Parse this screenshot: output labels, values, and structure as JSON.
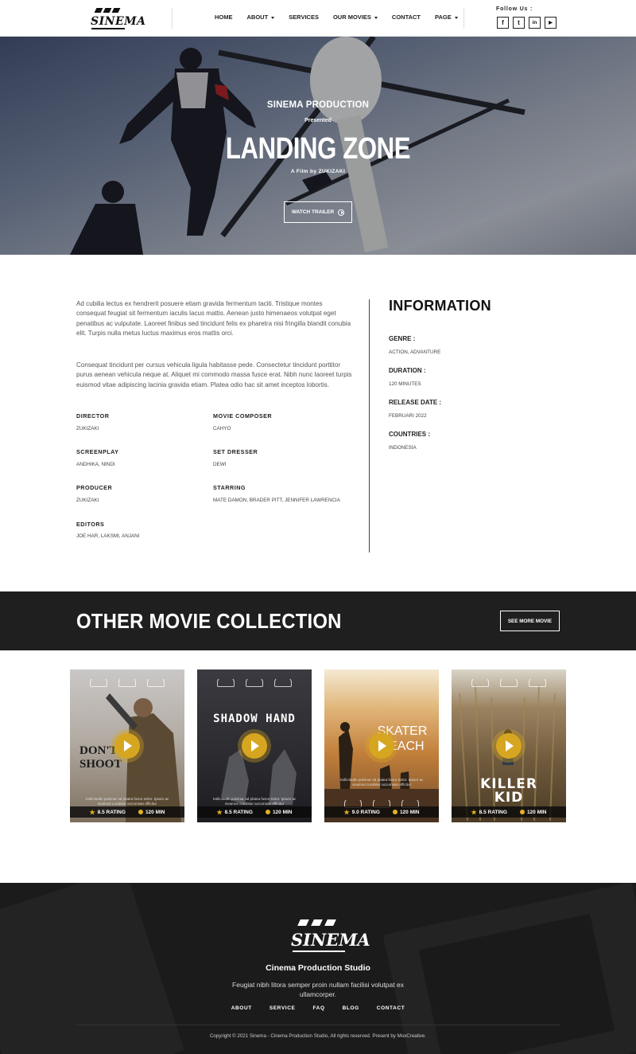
{
  "header": {
    "logo_text": "SINEMA",
    "nav": [
      {
        "label": "HOME",
        "dropdown": false
      },
      {
        "label": "ABOUT",
        "dropdown": true
      },
      {
        "label": "SERVICES",
        "dropdown": false
      },
      {
        "label": "OUR MOVIES",
        "dropdown": true
      },
      {
        "label": "CONTACT",
        "dropdown": false
      },
      {
        "label": "PAGE",
        "dropdown": true
      }
    ],
    "follow_label": "Follow Us :",
    "social": [
      {
        "icon": "facebook-icon",
        "glyph": "f"
      },
      {
        "icon": "twitter-icon",
        "glyph": "t"
      },
      {
        "icon": "linkedin-icon",
        "glyph": "in"
      },
      {
        "icon": "youtube-icon",
        "glyph": "▶"
      }
    ]
  },
  "hero": {
    "studio": "SINEMA PRODUCTION",
    "presented": "Presented",
    "title": "LANDING ZONE",
    "byline": "A Film by ZUKIZAKI",
    "button_label": "WATCH TRAILER"
  },
  "details": {
    "paragraphs": [
      "Ad cubilia lectus ex hendrerit posuere etiam gravida fermentum taciti. Tristique montes consequat feugiat sit fermentum iaculis lacus mattis. Aenean justo himenaeos volutpat eget penatibus ac vulputate. Laoreet finibus sed tincidunt felis ex pharetra nisi fringilla blandit conubia elit. Turpis nulla metus luctus maximus eros mattis orci.",
      "Consequat tincidunt per cursus vehicula ligula habitasse pede. Consectetur tincidunt porttitor purus aenean vehicula neque at. Aliquet mi commodo massa fusce erat. Nibh nunc laoreet turpis euismod vitae adipiscing lacinia gravida etiam. Platea odio hac sit amet inceptos lobortis."
    ],
    "credits": [
      {
        "label": "DIRECTOR",
        "value": "ZUKIZAKI"
      },
      {
        "label": "MOVIE COMPOSER",
        "value": "CAHYO"
      },
      {
        "label": "SCREENPLAY",
        "value": "ANDHIKA, NINDI"
      },
      {
        "label": "SET DRESSER",
        "value": "DEWI"
      },
      {
        "label": "PRODUCER",
        "value": "ZUKIZAKI"
      },
      {
        "label": "STARRING",
        "value": "MATE DAMON, BRADER PITT, JENNIFER LAWRENCIA"
      },
      {
        "label": "EDITORS",
        "value": "JOE HAR, LAKSMI, ANJANI"
      }
    ]
  },
  "information": {
    "title": "INFORMATION",
    "items": [
      {
        "label": "GENRE :",
        "value": "ACTION, ADVANTURE"
      },
      {
        "label": "DURATION :",
        "value": "120 MINUTES"
      },
      {
        "label": "RELEASE DATE :",
        "value": "FEBRUARI 2022"
      },
      {
        "label": "COUNTRIES :",
        "value": "INDONESIA"
      }
    ]
  },
  "collection": {
    "title": "OTHER MOVIE COLLECTION",
    "button_label": "SEE MORE MOVIE",
    "movies": [
      {
        "poster_title_lines": [
          "DON'T",
          "SHOOT"
        ],
        "rating": "8.5 RATING",
        "duration": "120 MIN",
        "tiny": "Sollicitudin pulvinar ad platea fusce tortor. Ipsum ac vivamus curabitur accumsan efficitur",
        "bg": "#9a8f83"
      },
      {
        "poster_title_lines": [
          "SHADOW HAND"
        ],
        "rating": "8.5 RATING",
        "duration": "120 MIN",
        "tiny": "Sollicitudin pulvinar ad platea fusce tortor. Ipsum ac vivamus curabitur accumsan efficitur",
        "bg": "#2d2d33"
      },
      {
        "poster_title_lines": [
          "SKATER",
          "BEACH"
        ],
        "rating": "9.0 RATING",
        "duration": "120 MIN",
        "tiny": "Sollicitudin pulvinar ad platea fusce tortor. Ipsum ac vivamus curabitur accumsan efficitur",
        "bg": "#c08a4a"
      },
      {
        "poster_title_lines": [
          "KILLER",
          "KID"
        ],
        "rating": "8.5 RATING",
        "duration": "120 MIN",
        "tiny": "",
        "bg": "#7a6446"
      }
    ]
  },
  "footer": {
    "logo_text": "SINEMA",
    "title": "Cinema Production Studio",
    "description": "Feugiat nibh litora semper proin nullam facilisi volutpat ex ullamcorper.",
    "links": [
      "ABOUT",
      "SERVICE",
      "FAQ",
      "BLOG",
      "CONTACT"
    ],
    "copyright": "Copyright © 2021 Sinema - Cinema Production Studio, All rights reserved. Present by MoxCreative."
  },
  "colors": {
    "accent": "#d6a620",
    "dark_band": "#1f1f1f",
    "footer_bg": "#1b1b1b"
  }
}
